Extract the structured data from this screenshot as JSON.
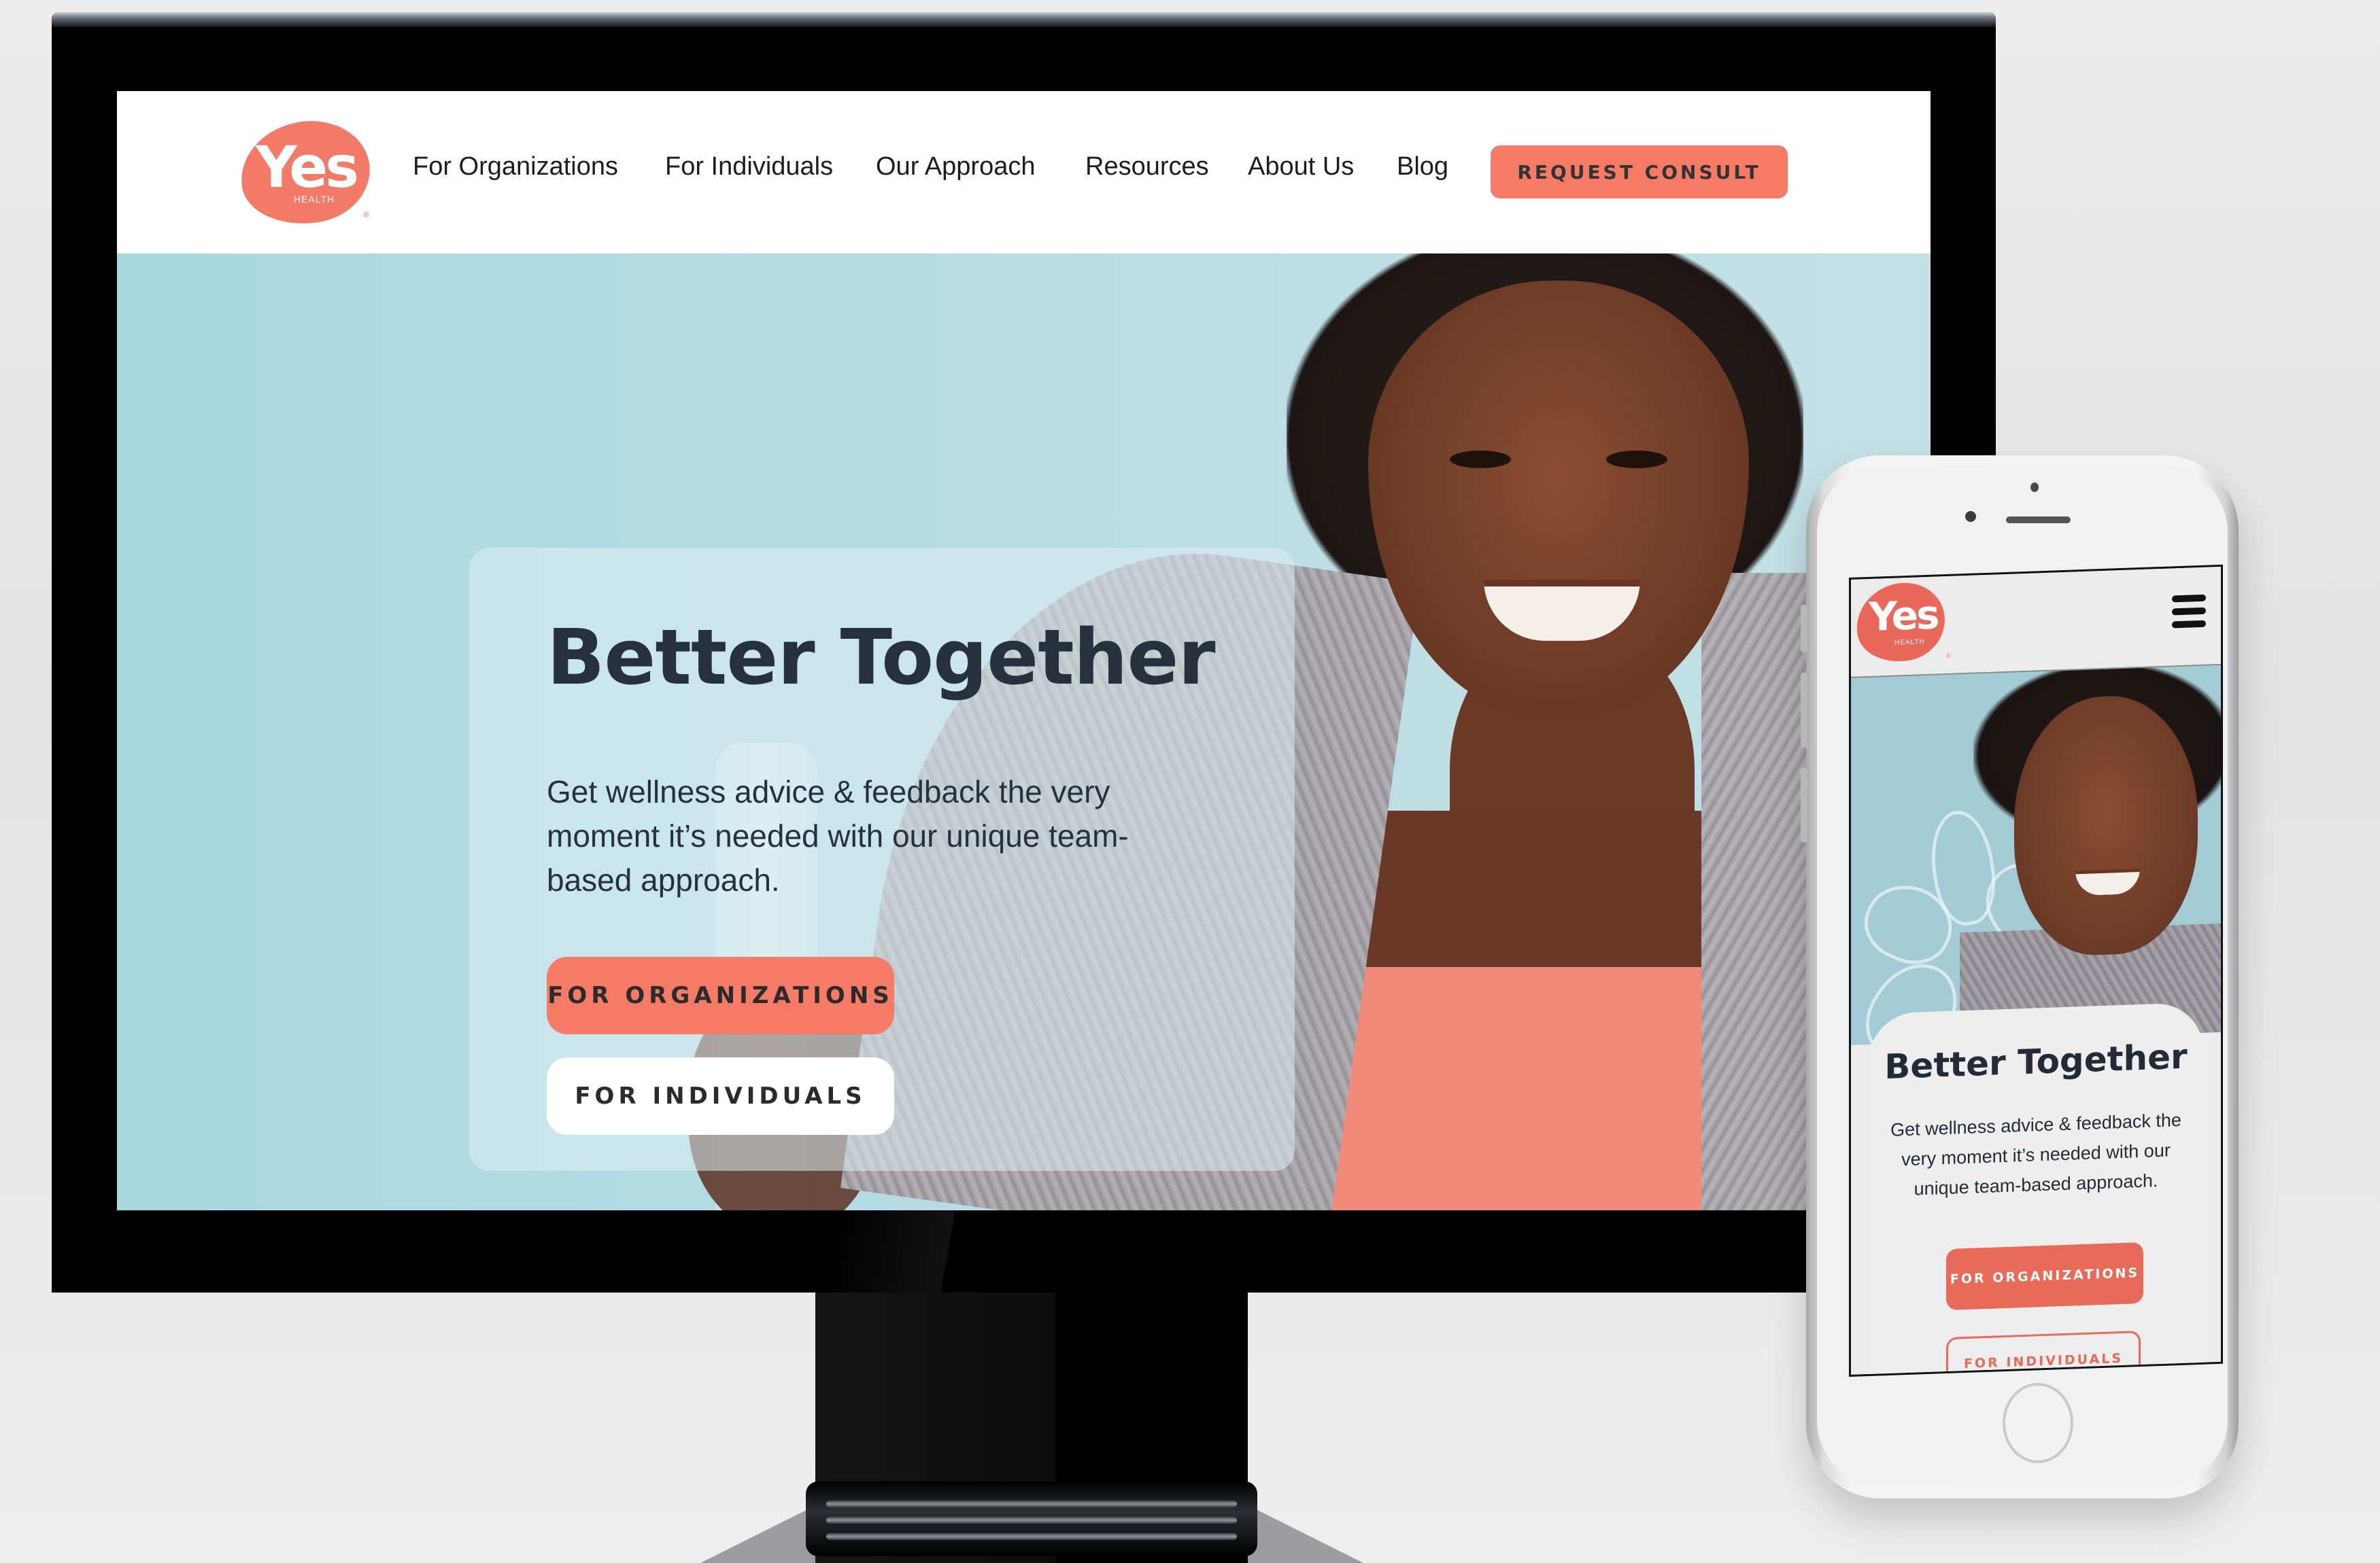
{
  "brand": {
    "name": "Yes",
    "subname": "HEALTH",
    "registered_mark": "®",
    "accent_color": "#f57b66",
    "text_color": "#26313d",
    "hero_bg_color": "#b4dbe2"
  },
  "desktop": {
    "nav": {
      "items": [
        {
          "label": "For Organizations"
        },
        {
          "label": "For Individuals"
        },
        {
          "label": "Our Approach"
        },
        {
          "label": "Resources"
        },
        {
          "label": "About Us"
        },
        {
          "label": "Blog"
        }
      ],
      "cta_label": "REQUEST CONSULT"
    },
    "hero": {
      "heading": "Better Together",
      "text": "Get wellness advice & feedback the very moment it’s needed with our unique team-based approach.",
      "buttons": [
        {
          "label": "FOR ORGANIZATIONS",
          "style": "filled"
        },
        {
          "label": "FOR INDIVIDUALS",
          "style": "white"
        }
      ],
      "image": "smiling-woman-with-towel-holding-water-bottle"
    }
  },
  "mobile": {
    "menu_icon": "hamburger-icon",
    "hero": {
      "heading": "Better Together",
      "text": "Get wellness advice & feedback the very moment it’s needed with our unique team-based approach.",
      "buttons": [
        {
          "label": "FOR ORGANIZATIONS",
          "style": "filled"
        },
        {
          "label": "FOR INDIVIDUALS",
          "style": "outline"
        }
      ],
      "image": "smiling-woman-with-towel",
      "decoration": "flower-outline"
    }
  }
}
